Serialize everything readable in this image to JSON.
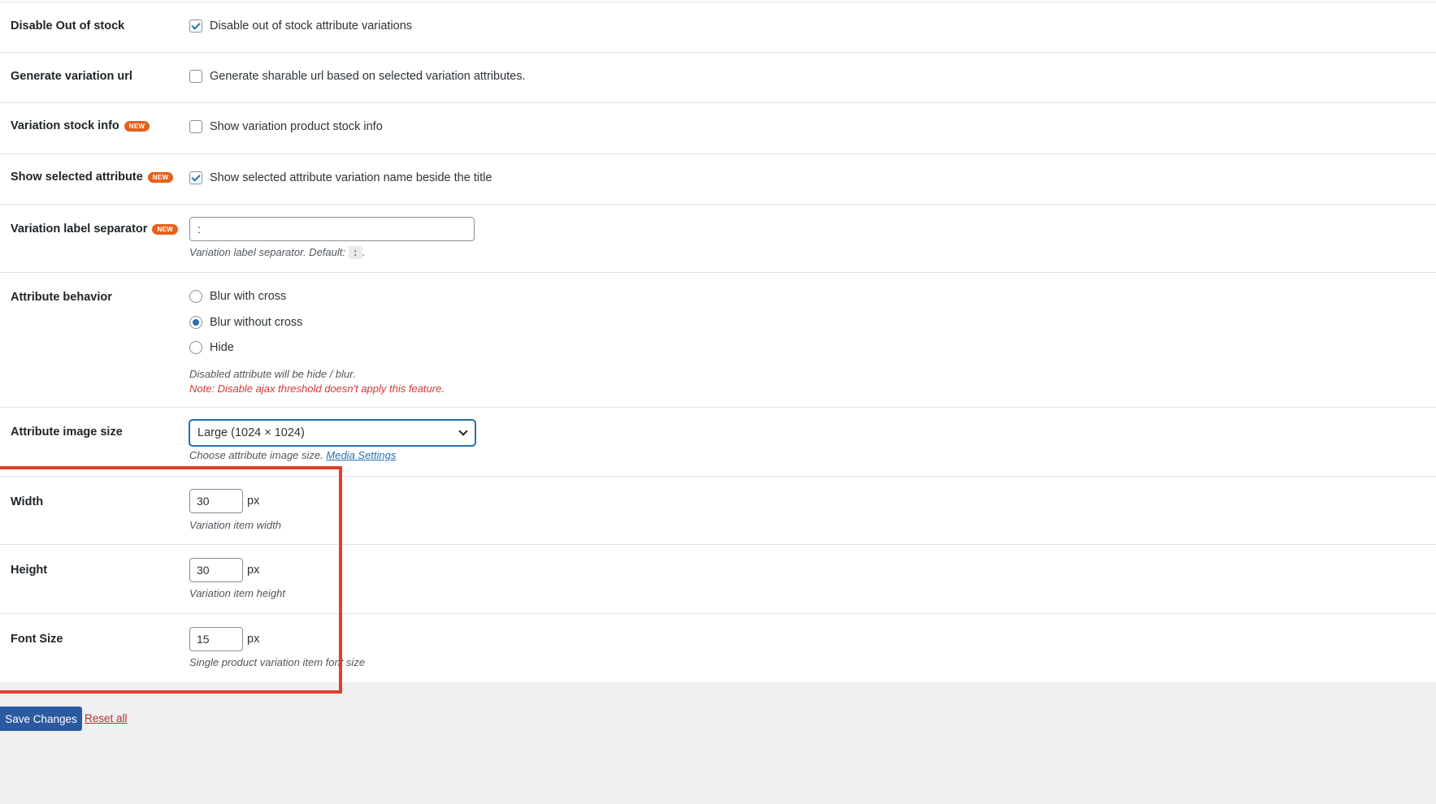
{
  "settings": {
    "disable_out_of_stock": {
      "label": "Disable Out of stock",
      "checkbox_label": "Disable out of stock attribute variations",
      "checked": true
    },
    "generate_variation_url": {
      "label": "Generate variation url",
      "checkbox_label": "Generate sharable url based on selected variation attributes.",
      "checked": false
    },
    "variation_stock_info": {
      "label": "Variation stock info",
      "badge": "NEW",
      "checkbox_label": "Show variation product stock info",
      "checked": false
    },
    "show_selected_attribute": {
      "label": "Show selected attribute",
      "badge": "NEW",
      "checkbox_label": "Show selected attribute variation name beside the title",
      "checked": true
    },
    "variation_label_separator": {
      "label": "Variation label separator",
      "badge": "NEW",
      "value": ":",
      "desc_prefix": "Variation label separator. Default:",
      "default_code": ":",
      "desc_suffix": "."
    },
    "attribute_behavior": {
      "label": "Attribute behavior",
      "options": [
        "Blur with cross",
        "Blur without cross",
        "Hide"
      ],
      "selected": "Blur without cross",
      "desc": "Disabled attribute will be hide / blur.",
      "note": "Note: Disable ajax threshold doesn't apply this feature."
    },
    "attribute_image_size": {
      "label": "Attribute image size",
      "selected": "Large (1024 × 1024)",
      "desc_prefix": "Choose attribute image size.",
      "link": "Media Settings"
    },
    "width": {
      "label": "Width",
      "value": "30",
      "unit": "px",
      "desc": "Variation item width"
    },
    "height": {
      "label": "Height",
      "value": "30",
      "unit": "px",
      "desc": "Variation item height"
    },
    "font_size": {
      "label": "Font Size",
      "value": "15",
      "unit": "px",
      "desc": "Single product variation item font size"
    }
  },
  "actions": {
    "save_label": "Save Changes",
    "reset_label": "Reset all"
  },
  "colors": {
    "accent": "#2271b1",
    "badge": "#e2621b",
    "highlight_border": "#e0402a",
    "danger": "#d63638",
    "save_button": "#2c5aa0"
  }
}
